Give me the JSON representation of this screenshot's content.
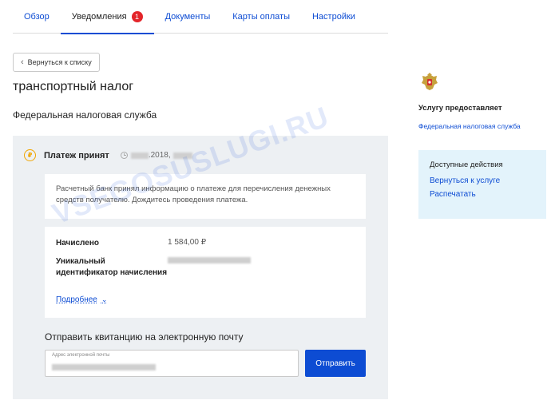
{
  "tabs": [
    {
      "label": "Обзор",
      "active": false
    },
    {
      "label": "Уведомления",
      "active": true,
      "badge": "1"
    },
    {
      "label": "Документы",
      "active": false
    },
    {
      "label": "Карты оплаты",
      "active": false
    },
    {
      "label": "Настройки",
      "active": false
    }
  ],
  "back_button": {
    "label": "Вернуться к списку",
    "icon": "chevron-left-icon"
  },
  "page_title": "транспортный налог",
  "department": "Федеральная налоговая служба",
  "payment": {
    "status": "Платеж принят",
    "status_icon": "ruble-circle-icon",
    "date_suffix": ".2018,",
    "info_text": "Расчетный банк принял информацию о платеже для перечисления денежных средств получателю. Дождитесь проведения платежа.",
    "charged_label": "Начислено",
    "charged_value": "1 584,00 ₽",
    "uid_label_line1": "Уникальный",
    "uid_label_line2": "идентификатор начисления",
    "more_link": "Подробнее"
  },
  "email_receipt": {
    "title": "Отправить квитанцию на электронную почту",
    "field_label": "Адрес электронной почты",
    "send_button": "Отправить"
  },
  "sidebar": {
    "provider_label": "Услугу предоставляет",
    "provider_link": "Федеральная налоговая служба",
    "actions_title": "Доступные действия",
    "actions": [
      "Вернуться к услуге",
      "Распечатать"
    ]
  },
  "watermark": "VSEGOSUSLUGI.RU",
  "colors": {
    "accent": "#0d4cd3",
    "badge": "#e3252a",
    "status_icon": "#f0a500",
    "actions_bg": "#e3f3fb"
  }
}
